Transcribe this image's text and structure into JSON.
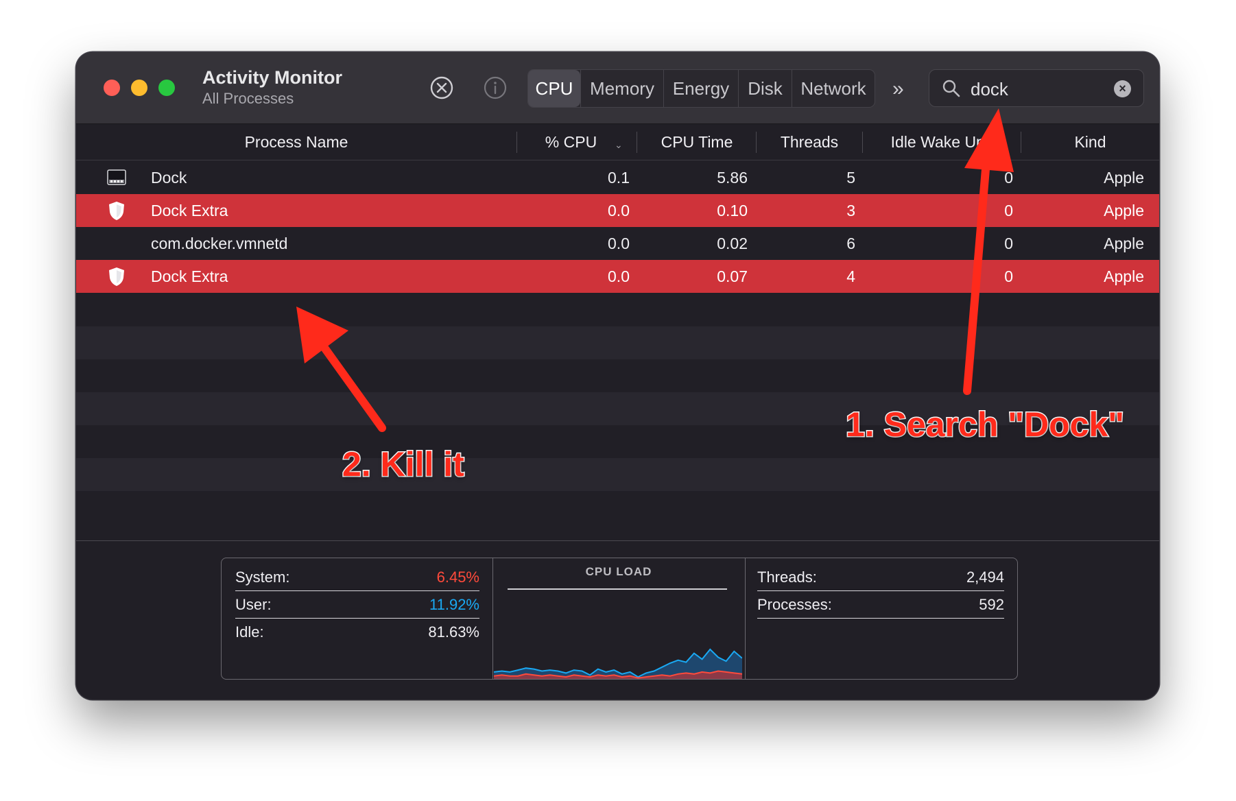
{
  "window": {
    "title": "Activity Monitor",
    "subtitle": "All Processes"
  },
  "toolbar": {
    "stop_icon": "stop-process-icon",
    "info_icon": "inspect-info-icon",
    "tabs": [
      "CPU",
      "Memory",
      "Energy",
      "Disk",
      "Network"
    ],
    "active_tab": "CPU",
    "overflow_label": "»",
    "search": {
      "query": "dock",
      "clear_label": "×"
    }
  },
  "table": {
    "columns": [
      "Process Name",
      "% CPU",
      "CPU Time",
      "Threads",
      "Idle Wake Ups",
      "Kind"
    ],
    "sort_column": "% CPU",
    "rows": [
      {
        "name": "Dock",
        "cpu": "0.1",
        "cpu_time": "5.86",
        "threads": "5",
        "idle_wake_ups": "0",
        "kind": "Apple",
        "icon": "dock-app-icon",
        "highlighted": false
      },
      {
        "name": "Dock Extra",
        "cpu": "0.0",
        "cpu_time": "0.10",
        "threads": "3",
        "idle_wake_ups": "0",
        "kind": "Apple",
        "icon": "shield-icon",
        "highlighted": true
      },
      {
        "name": "com.docker.vmnetd",
        "cpu": "0.0",
        "cpu_time": "0.02",
        "threads": "6",
        "idle_wake_ups": "0",
        "kind": "Apple",
        "icon": "",
        "highlighted": false
      },
      {
        "name": "Dock Extra",
        "cpu": "0.0",
        "cpu_time": "0.07",
        "threads": "4",
        "idle_wake_ups": "0",
        "kind": "Apple",
        "icon": "shield-icon",
        "highlighted": true
      }
    ]
  },
  "summary": {
    "system_label": "System:",
    "system_value": "6.45%",
    "user_label": "User:",
    "user_value": "11.92%",
    "idle_label": "Idle:",
    "idle_value": "81.63%",
    "load_title": "CPU LOAD",
    "threads_label": "Threads:",
    "threads_value": "2,494",
    "processes_label": "Processes:",
    "processes_value": "592"
  },
  "cpu_load_graph": {
    "system": [
      3,
      4,
      3,
      3,
      5,
      4,
      3,
      4,
      3,
      2,
      4,
      3,
      2,
      4,
      3,
      4,
      2,
      3,
      1,
      2,
      3,
      4,
      3,
      5,
      6,
      5,
      7,
      6,
      8,
      7,
      6,
      5
    ],
    "user": [
      7,
      8,
      7,
      9,
      11,
      10,
      8,
      9,
      8,
      6,
      9,
      8,
      4,
      10,
      7,
      9,
      5,
      7,
      2,
      6,
      8,
      12,
      16,
      19,
      17,
      26,
      20,
      30,
      22,
      18,
      28,
      21
    ]
  },
  "colors": {
    "highlight_row": "#cf333a",
    "system_value": "#ff4a3b",
    "user_value": "#1aa9f3",
    "annotation": "#ff2a1b"
  },
  "annotations": {
    "step1": "1. Search \"Dock\"",
    "step2": "2. Kill it"
  }
}
